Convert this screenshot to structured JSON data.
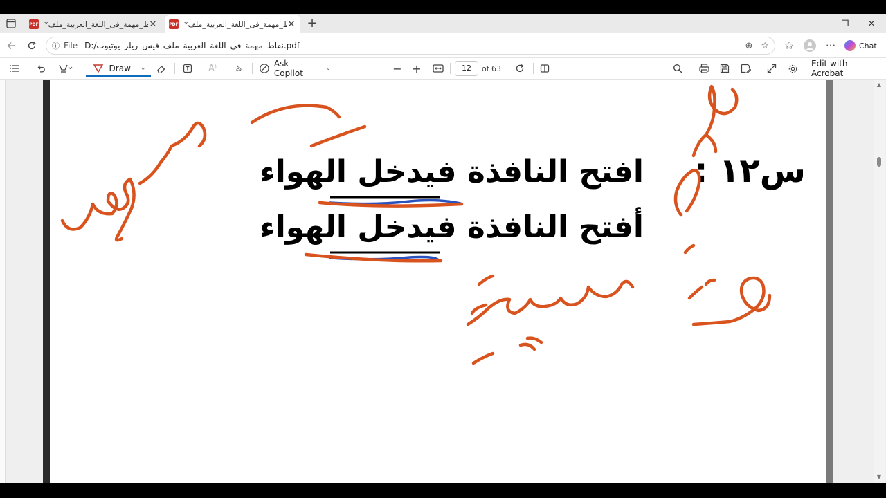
{
  "tabs": [
    {
      "title": "*نقاط_مهمة_فى_اللغة_العربية_ملف",
      "close": "✕",
      "fav": "PDF"
    },
    {
      "title": "*نقاط_مهمة_فى_اللغة_العربية_ملف",
      "close": "✕",
      "fav": "PDF"
    }
  ],
  "window": {
    "new_tab": "+",
    "minimize": "—",
    "maximize": "❐",
    "close": "✕"
  },
  "address": {
    "info_icon": "ⓘ",
    "scheme_label": "File",
    "url": "D:/نقاط_مهمة_فى_اللغة_العربية_ملف_فيس_ريلز_يوتيوب.pdf",
    "chat_label": "Chat"
  },
  "pdf_toolbar": {
    "draw_label": "Draw",
    "ask_copilot_label": "Ask Copilot",
    "page_number": "12",
    "page_total": "of 63",
    "edit_label": "Edit with Acrobat"
  },
  "document": {
    "question_label": "س١٢ :",
    "line1": "افتح النافذة فيدخل الهواء",
    "line2": "أفتح النافذة فيدخل الهواء"
  },
  "annotation_colors": {
    "ink": "#d9531e",
    "blue": "#2a52be"
  }
}
